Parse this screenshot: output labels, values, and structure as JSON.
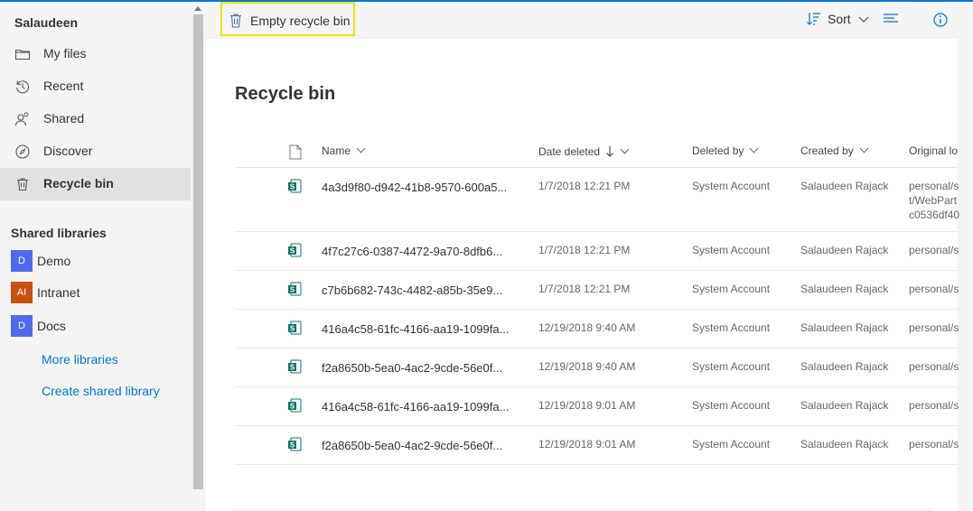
{
  "sidebar": {
    "user": "Salaudeen",
    "nav": [
      {
        "label": "My files",
        "icon": "folder-icon"
      },
      {
        "label": "Recent",
        "icon": "history-icon"
      },
      {
        "label": "Shared",
        "icon": "shared-people-icon"
      },
      {
        "label": "Discover",
        "icon": "discover-compass-icon"
      },
      {
        "label": "Recycle bin",
        "icon": "recycle-bin-icon",
        "selected": true
      }
    ],
    "shared_libraries_title": "Shared libraries",
    "libraries": [
      {
        "badge": "D",
        "label": "Demo",
        "color": "#4f6bed"
      },
      {
        "badge": "AI",
        "label": "Intranet",
        "color": "#ca5010"
      },
      {
        "badge": "D",
        "label": "Docs",
        "color": "#4f6bed"
      }
    ],
    "more_libraries": "More libraries",
    "create_library": "Create shared library"
  },
  "toolbar": {
    "empty_recycle_bin": "Empty recycle bin",
    "sort": "Sort"
  },
  "main": {
    "title": "Recycle bin",
    "columns": {
      "name": "Name",
      "date_deleted": "Date deleted",
      "deleted_by": "Deleted by",
      "created_by": "Created by",
      "original_location": "Original lo"
    },
    "rows": [
      {
        "name": "4a3d9f80-d942-41b8-9570-600a5...",
        "date": "1/7/2018 12:21 PM",
        "deleted_by": "System Account",
        "created_by": "Salaudeen Rajack",
        "location": [
          "personal/s",
          "t/WebPart",
          "c0536df40"
        ]
      },
      {
        "name": "4f7c27c6-0387-4472-9a70-8dfb6...",
        "date": "1/7/2018 12:21 PM",
        "deleted_by": "System Account",
        "created_by": "Salaudeen Rajack",
        "location": [
          "personal/s"
        ]
      },
      {
        "name": "c7b6b682-743c-4482-a85b-35e9...",
        "date": "1/7/2018 12:21 PM",
        "deleted_by": "System Account",
        "created_by": "Salaudeen Rajack",
        "location": [
          "personal/s"
        ]
      },
      {
        "name": "416a4c58-61fc-4166-aa19-1099fa...",
        "date": "12/19/2018 9:40 AM",
        "deleted_by": "System Account",
        "created_by": "Salaudeen Rajack",
        "location": [
          "personal/s"
        ]
      },
      {
        "name": "f2a8650b-5ea0-4ac2-9cde-56e0f...",
        "date": "12/19/2018 9:40 AM",
        "deleted_by": "System Account",
        "created_by": "Salaudeen Rajack",
        "location": [
          "personal/s"
        ]
      },
      {
        "name": "416a4c58-61fc-4166-aa19-1099fa...",
        "date": "12/19/2018 9:01 AM",
        "deleted_by": "System Account",
        "created_by": "Salaudeen Rajack",
        "location": [
          "personal/s"
        ]
      },
      {
        "name": "f2a8650b-5ea0-4ac2-9cde-56e0f...",
        "date": "12/19/2018 9:01 AM",
        "deleted_by": "System Account",
        "created_by": "Salaudeen Rajack",
        "location": [
          "personal/s"
        ]
      }
    ]
  },
  "colors": {
    "accent": "#0078d4",
    "highlight": "#e8e800",
    "file_icon": "#077568"
  }
}
